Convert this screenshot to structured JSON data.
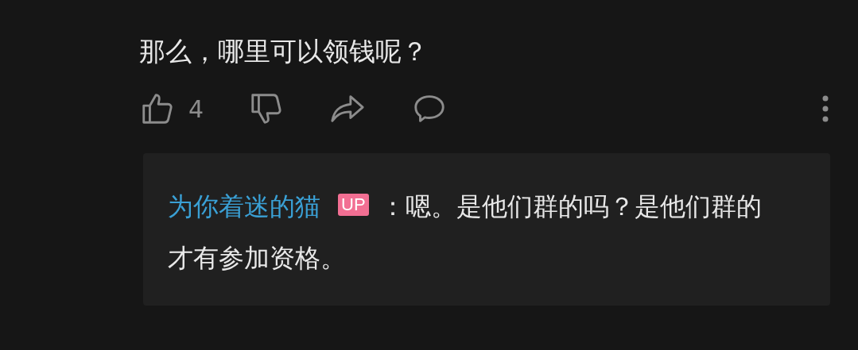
{
  "comment": {
    "text": "那么，哪里可以领钱呢？",
    "likes": "4"
  },
  "reply": {
    "author": "为你着迷的猫",
    "badge": "UP",
    "separator": "：",
    "text": "嗯。是他们群的吗？是他们群的才有参加资格。"
  }
}
